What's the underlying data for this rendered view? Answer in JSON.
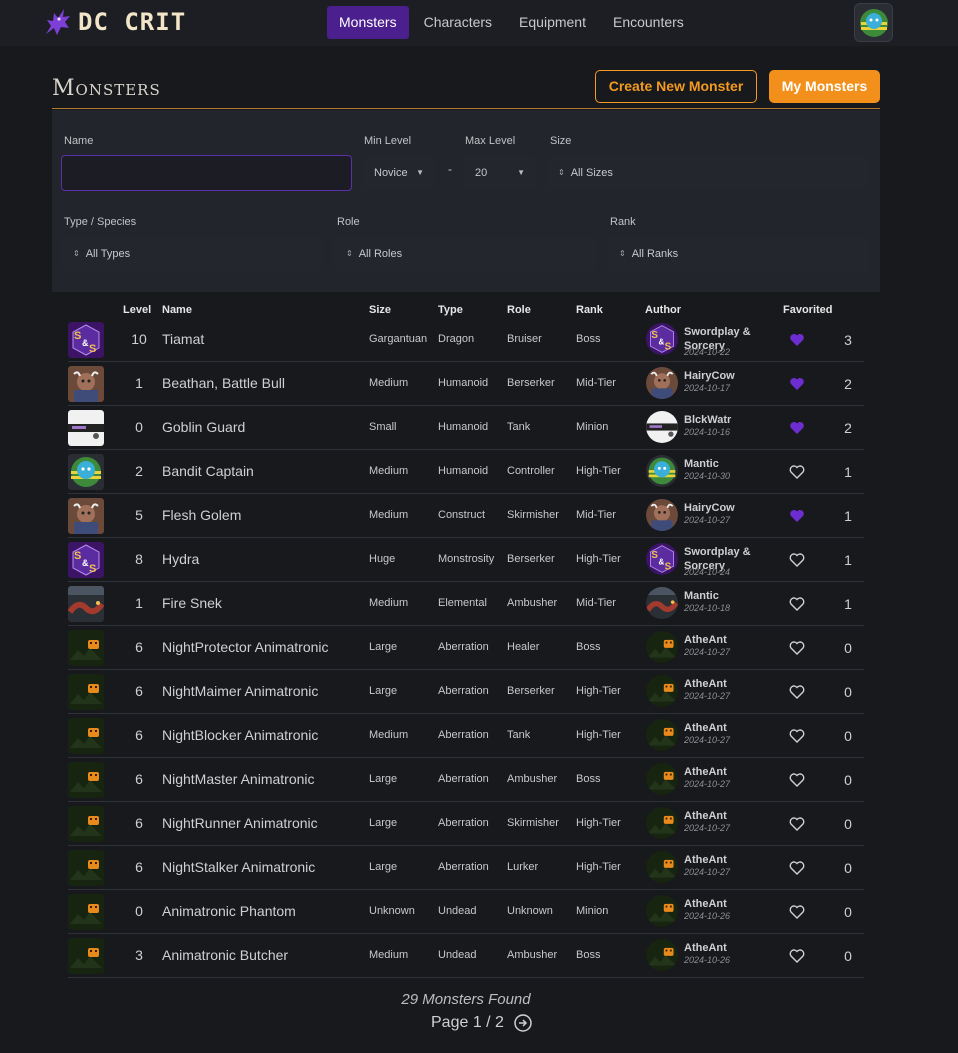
{
  "brand": {
    "name": "DC CRIT"
  },
  "nav": [
    {
      "label": "Monsters",
      "active": true
    },
    {
      "label": "Characters",
      "active": false
    },
    {
      "label": "Equipment",
      "active": false
    },
    {
      "label": "Encounters",
      "active": false
    }
  ],
  "header": {
    "title": "Monsters",
    "create_button": "Create New Monster",
    "mine_button": "My Monsters"
  },
  "filters": {
    "name_label": "Name",
    "name_value": "",
    "min_level_label": "Min Level",
    "min_level_value": "Novice",
    "max_level_label": "Max Level",
    "max_level_value": "20",
    "range_separator": "-",
    "size_label": "Size",
    "size_value": "All Sizes",
    "type_label": "Type / Species",
    "type_value": "All Types",
    "role_label": "Role",
    "role_value": "All Roles",
    "rank_label": "Rank",
    "rank_value": "All Ranks"
  },
  "table": {
    "headers": {
      "level": "Level",
      "name": "Name",
      "size": "Size",
      "type": "Type",
      "role": "Role",
      "rank": "Rank",
      "author": "Author",
      "favorited": "Favorited"
    },
    "rows": [
      {
        "icon": "sorcery-icon",
        "level": "10",
        "name": "Tiamat",
        "size": "Gargantuan",
        "type": "Dragon",
        "role": "Bruiser",
        "rank": "Boss",
        "author": "Swordplay & Sorcery",
        "date": "2024-10-22",
        "favorited": true,
        "count": "3"
      },
      {
        "icon": "minotaur-icon",
        "level": "1",
        "name": "Beathan, Battle Bull",
        "size": "Medium",
        "type": "Humanoid",
        "role": "Berserker",
        "rank": "Mid-Tier",
        "author": "HairyCow",
        "date": "2024-10-17",
        "favorited": true,
        "count": "2"
      },
      {
        "icon": "goblin-icon",
        "level": "0",
        "name": "Goblin Guard",
        "size": "Small",
        "type": "Humanoid",
        "role": "Tank",
        "rank": "Minion",
        "author": "BlckWatr",
        "date": "2024-10-16",
        "favorited": true,
        "count": "2"
      },
      {
        "icon": "bot-icon",
        "level": "2",
        "name": "Bandit Captain",
        "size": "Medium",
        "type": "Humanoid",
        "role": "Controller",
        "rank": "High-Tier",
        "author": "Mantic",
        "date": "2024-10-30",
        "favorited": false,
        "count": "1"
      },
      {
        "icon": "minotaur-icon",
        "level": "5",
        "name": "Flesh Golem",
        "size": "Medium",
        "type": "Construct",
        "role": "Skirmisher",
        "rank": "Mid-Tier",
        "author": "HairyCow",
        "date": "2024-10-27",
        "favorited": true,
        "count": "1"
      },
      {
        "icon": "sorcery-icon",
        "level": "8",
        "name": "Hydra",
        "size": "Huge",
        "type": "Monstrosity",
        "role": "Berserker",
        "rank": "High-Tier",
        "author": "Swordplay & Sorcery",
        "date": "2024-10-24",
        "favorited": false,
        "count": "1"
      },
      {
        "icon": "snake-icon",
        "level": "1",
        "name": "Fire Snek",
        "size": "Medium",
        "type": "Elemental",
        "role": "Ambusher",
        "rank": "Mid-Tier",
        "author": "Mantic",
        "date": "2024-10-18",
        "favorited": false,
        "count": "1"
      },
      {
        "icon": "animatronic-icon",
        "level": "6",
        "name": "NightProtector Animatronic",
        "size": "Large",
        "type": "Aberration",
        "role": "Healer",
        "rank": "Boss",
        "author": "AtheAnt",
        "date": "2024-10-27",
        "favorited": false,
        "count": "0"
      },
      {
        "icon": "animatronic-icon",
        "level": "6",
        "name": "NightMaimer Animatronic",
        "size": "Large",
        "type": "Aberration",
        "role": "Berserker",
        "rank": "High-Tier",
        "author": "AtheAnt",
        "date": "2024-10-27",
        "favorited": false,
        "count": "0"
      },
      {
        "icon": "animatronic-icon",
        "level": "6",
        "name": "NightBlocker Animatronic",
        "size": "Medium",
        "type": "Aberration",
        "role": "Tank",
        "rank": "High-Tier",
        "author": "AtheAnt",
        "date": "2024-10-27",
        "favorited": false,
        "count": "0"
      },
      {
        "icon": "animatronic-icon",
        "level": "6",
        "name": "NightMaster Animatronic",
        "size": "Large",
        "type": "Aberration",
        "role": "Ambusher",
        "rank": "Boss",
        "author": "AtheAnt",
        "date": "2024-10-27",
        "favorited": false,
        "count": "0"
      },
      {
        "icon": "animatronic-icon",
        "level": "6",
        "name": "NightRunner Animatronic",
        "size": "Large",
        "type": "Aberration",
        "role": "Skirmisher",
        "rank": "High-Tier",
        "author": "AtheAnt",
        "date": "2024-10-27",
        "favorited": false,
        "count": "0"
      },
      {
        "icon": "animatronic-icon",
        "level": "6",
        "name": "NightStalker Animatronic",
        "size": "Large",
        "type": "Aberration",
        "role": "Lurker",
        "rank": "High-Tier",
        "author": "AtheAnt",
        "date": "2024-10-27",
        "favorited": false,
        "count": "0"
      },
      {
        "icon": "animatronic-icon",
        "level": "0",
        "name": "Animatronic Phantom",
        "size": "Unknown",
        "type": "Undead",
        "role": "Unknown",
        "rank": "Minion",
        "author": "AtheAnt",
        "date": "2024-10-26",
        "favorited": false,
        "count": "0"
      },
      {
        "icon": "animatronic-icon",
        "level": "3",
        "name": "Animatronic Butcher",
        "size": "Medium",
        "type": "Undead",
        "role": "Ambusher",
        "rank": "Boss",
        "author": "AtheAnt",
        "date": "2024-10-26",
        "favorited": false,
        "count": "0"
      }
    ]
  },
  "footer": {
    "found": "29 Monsters Found",
    "page": "Page 1 / 2"
  },
  "colors": {
    "accent_purple": "#4c1f8f",
    "heart_purple": "#6d2ed1",
    "orange": "#f3901c",
    "background": "#17191d"
  }
}
